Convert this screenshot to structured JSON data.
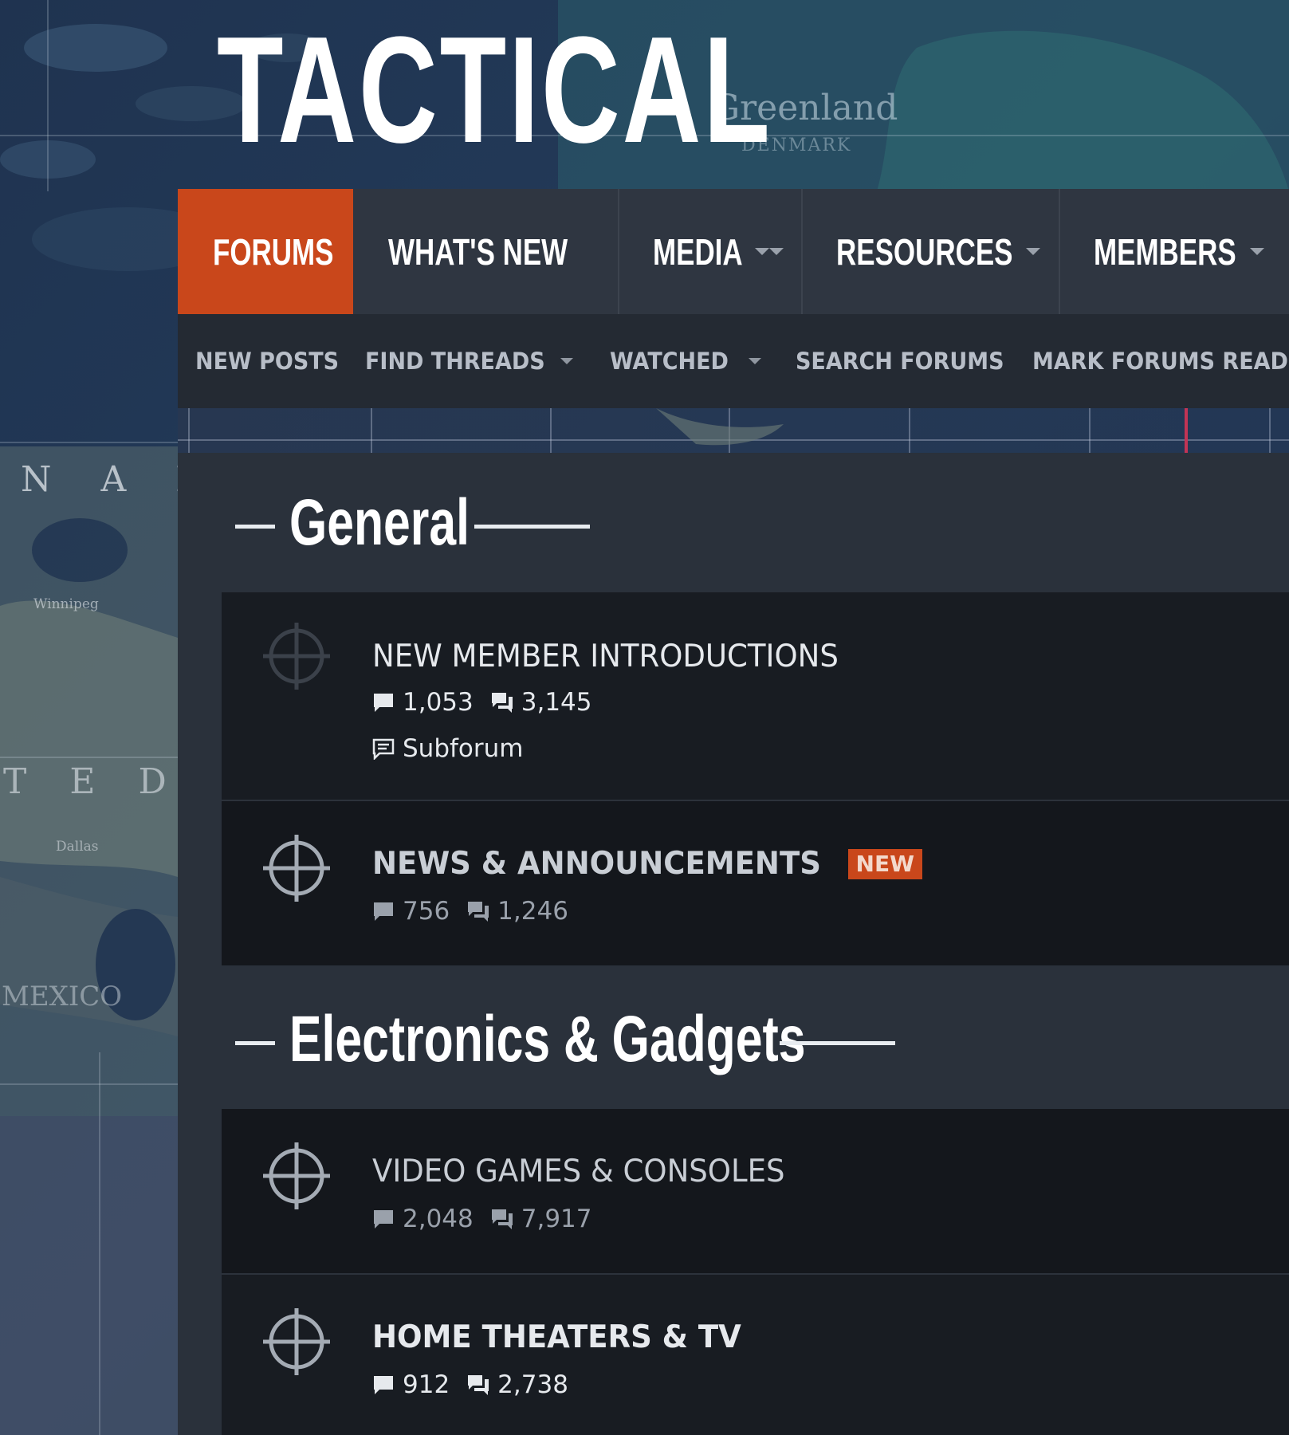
{
  "map": {
    "labels": {
      "greenland": "Greenland",
      "denmark": "DENMARK",
      "canada": "N A D",
      "winnipeg": "Winnipeg",
      "united_states": "T E D   S T",
      "dallas": "Dallas",
      "mexico": "MEXICO"
    }
  },
  "site": {
    "logo": "TACTICAL"
  },
  "primary_nav": {
    "tabs": [
      {
        "label": "FORUMS",
        "active": true
      },
      {
        "label": "WHAT'S NEW"
      },
      {
        "label": "MEDIA"
      },
      {
        "label": "RESOURCES"
      },
      {
        "label": "MEMBERS"
      }
    ]
  },
  "secondary_nav": {
    "items": [
      {
        "label": "NEW POSTS"
      },
      {
        "label": "FIND THREADS"
      },
      {
        "label": "WATCHED"
      },
      {
        "label": "SEARCH FORUMS"
      },
      {
        "label": "MARK FORUMS READ"
      }
    ]
  },
  "categories": [
    {
      "title": "General",
      "nodes": [
        {
          "title": "NEW MEMBER INTRODUCTIONS",
          "threads": "1,053",
          "messages": "3,145",
          "subforum": "Subforum"
        },
        {
          "title": "NEWS & ANNOUNCEMENTS",
          "badge": "NEW",
          "threads": "756",
          "messages": "1,246"
        }
      ]
    },
    {
      "title": "Electronics & Gadgets",
      "nodes": [
        {
          "title": "VIDEO GAMES & CONSOLES",
          "threads": "2,048",
          "messages": "7,917"
        },
        {
          "title": "HOME THEATERS & TV",
          "threads": "912",
          "messages": "2,738"
        }
      ]
    }
  ],
  "colors": {
    "accent": "#c9471b",
    "nav_bg": "#2f3641",
    "subnav_bg": "#242a33",
    "content_bg": "#2a313b",
    "node_bg": "#181c22"
  }
}
